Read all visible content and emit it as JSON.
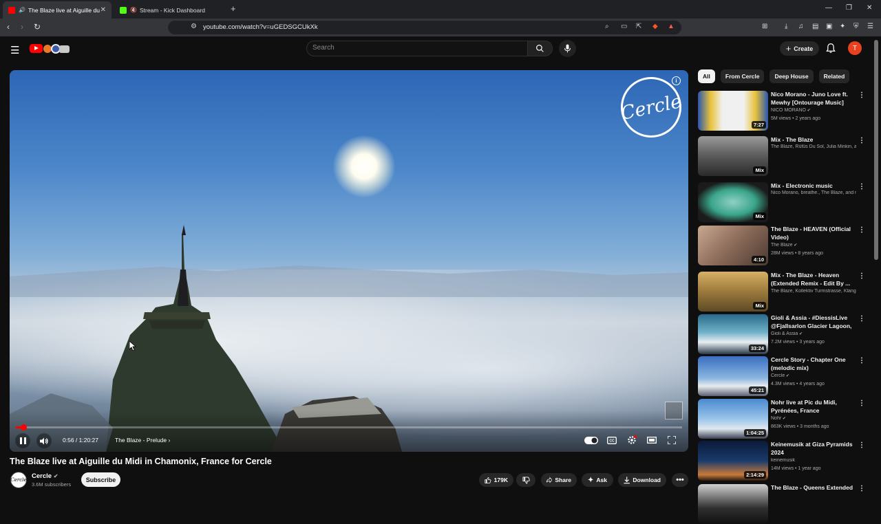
{
  "browser": {
    "tabs": [
      {
        "title": "The Blaze live at Aiguille du M",
        "active": true
      },
      {
        "title": "Stream - Kick Dashboard",
        "active": false
      }
    ],
    "url": "youtube.com/watch?v=uGEDSGCUkXk"
  },
  "header": {
    "search_placeholder": "Search",
    "create_label": "Create",
    "avatar_letter": "T"
  },
  "player": {
    "overlay_logo": "Cercle",
    "time": "0:56 / 1:20:27",
    "chapter": "The Blaze - Prelude",
    "progress": 0.0116
  },
  "video": {
    "title": "The Blaze live at Aiguille du Midi in Chamonix, France for Cercle",
    "channel": "Cercle",
    "subscribers": "3.6M subscribers",
    "subscribe_label": "Subscribe",
    "likes": "179K",
    "share_label": "Share",
    "ask_label": "Ask",
    "download_label": "Download"
  },
  "sidebar": {
    "chips": [
      "All",
      "From Cercle",
      "Deep House",
      "Related"
    ],
    "recommendations": [
      {
        "title": "Nico Morano - Juno Love ft. Mewhy [Ontourage Music]",
        "channel": "NICO MORANO",
        "verified": true,
        "meta": "5M views • 2 years ago",
        "badge": "7:27",
        "thumb": "linear-gradient(90deg,#2a56b0 0%,#e8c23a 18%,#f0f0f0 35%,#f0f0f0 65%,#e8c23a 82%,#2a56b0 100%)"
      },
      {
        "title": "Mix - The Blaze",
        "channel": "The Blaze, Rüfüs Du Sol, Julia Minkin, an...",
        "verified": false,
        "meta": "",
        "badge": "Mix",
        "thumb": "linear-gradient(180deg,#9a9a9a 0%,#5a5a5a 50%,#2a2a2a 100%)"
      },
      {
        "title": "Mix - Electronic music",
        "channel": "Nico Morano, breathe., The Blaze, and m...",
        "verified": false,
        "meta": "",
        "badge": "Mix",
        "thumb": "radial-gradient(ellipse at 50% 50%,#8fd1c4 0%,#3aa58a 45%,#1b1b1b 75%)"
      },
      {
        "title": "The Blaze - HEAVEN (Official Video)",
        "channel": "The Blaze",
        "verified": true,
        "meta": "28M views • 8 years ago",
        "badge": "4:10",
        "thumb": "linear-gradient(135deg,#c8a890 0%,#8a6a58 50%,#4a3a32 100%)"
      },
      {
        "title": "Mix - The Blaze - Heaven (Extended Remix - Edit By ...",
        "channel": "The Blaze, Kollektiv Turmstrasse, Klangk...",
        "verified": false,
        "meta": "",
        "badge": "Mix",
        "thumb": "linear-gradient(180deg,#d8b066 0%,#9c7a3c 50%,#5d4a26 100%)"
      },
      {
        "title": "Gioli & Assia - #DiessisLive @Fjallsarlon Glacier Lagoon, ...",
        "channel": "Gioli & Assia",
        "verified": true,
        "meta": "7.2M views • 3 years ago",
        "badge": "33:24",
        "thumb": "linear-gradient(180deg,#2a6a8a 0%,#6fb0c8 45%,#e8eef2 70%,#2a3a4a 100%)"
      },
      {
        "title": "Cercle Story - Chapter One (melodic mix)",
        "channel": "Cercle",
        "verified": true,
        "meta": "4.3M views • 4 years ago",
        "badge": "45:21",
        "thumb": "linear-gradient(180deg,#3a6ec0 0%,#8ab6e0 55%,#e8ecf0 75%,#5a6070 100%)"
      },
      {
        "title": "Nohr live at Pic du Midi, Pyrénées, France",
        "channel": "Nohr",
        "verified": true,
        "meta": "863K views • 3 months ago",
        "badge": "1:04:25",
        "thumb": "linear-gradient(180deg,#4a8ad0 0%,#9ac4ea 50%,#e0e8f0 75%,#3a4050 100%)"
      },
      {
        "title": "Keinemusik at Giza Pyramids 2024",
        "channel": "keinemusik",
        "verified": false,
        "meta": "14M views • 1 year ago",
        "badge": "2:14:29",
        "thumb": "linear-gradient(180deg,#0a1a3a 0%,#1a3a6a 50%,#c87a3a 85%,#2a1a10 100%)"
      },
      {
        "title": "The Blaze - Queens Extended",
        "channel": "",
        "verified": false,
        "meta": "",
        "badge": "",
        "thumb": "linear-gradient(180deg,#d0d0d0 0%,#303030 60%,#101010 100%)"
      }
    ]
  }
}
